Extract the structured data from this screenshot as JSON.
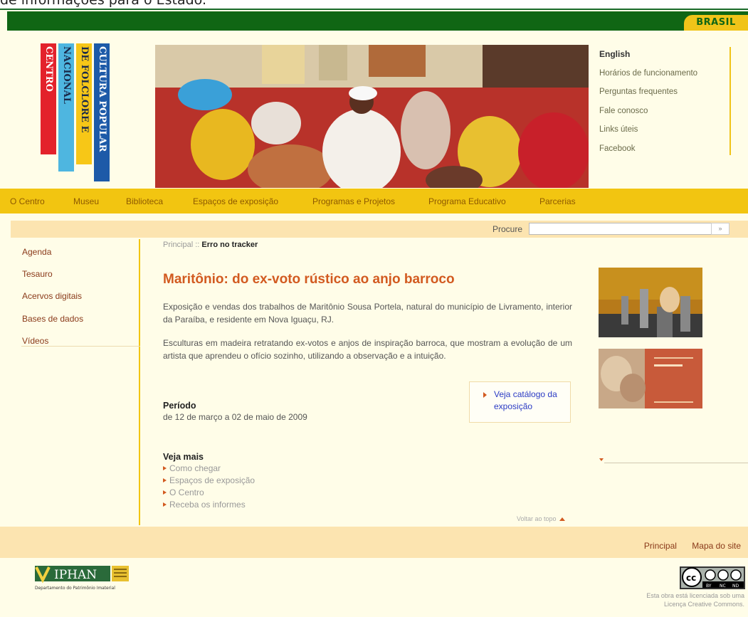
{
  "top_clip_text": "de informações para o Estado.",
  "gov_bar": {
    "brasil_label": "BRASIL"
  },
  "logo": {
    "line1": "CENTRO",
    "line2": "NACIONAL",
    "line3": "DE FOLCLORE E",
    "line4": "CULTURA POPULAR",
    "colors": [
      "#e3222b",
      "#4eb6e0",
      "#f7c717",
      "#1d5aa8"
    ]
  },
  "top_links": [
    "English",
    "Horários de funcionamento",
    "Perguntas frequentes",
    "Fale conosco",
    "Links úteis",
    "Facebook"
  ],
  "nav": [
    "O Centro",
    "Museu",
    "Biblioteca",
    "Espaços de exposição",
    "Programas e Projetos",
    "Programa Educativo",
    "Parcerias"
  ],
  "search": {
    "label": "Procure",
    "value": "",
    "button": "»"
  },
  "sidebar": [
    "Agenda",
    "Tesauro",
    "Acervos digitais",
    "Bases de dados",
    "Vídeos"
  ],
  "breadcrumb": {
    "home": "Principal",
    "sep": " :: ",
    "current": "Erro no tracker"
  },
  "main": {
    "title": "Maritônio: do ex-voto rústico ao anjo barroco",
    "para1": "Exposição e vendas dos trabalhos de Maritônio Sousa Portela, natural do município de Livramento, interior da Paraíba, e residente em Nova Iguaçu, RJ.",
    "para2": "Esculturas em madeira retratando ex-votos e anjos de inspiração barroca, que mostram a evolução de um artista que aprendeu o ofício sozinho, utilizando a observação e a intuição.",
    "catalog_link": "Veja catálogo da exposição",
    "period_label": "Período",
    "period_value": "de 12 de março a 02 de maio de 2009",
    "seemore_title": "Veja mais",
    "seemore_items": [
      "Como chegar",
      "Espaços de exposição",
      "O Centro",
      "Receba os informes"
    ],
    "back_to_top": "Voltar ao topo"
  },
  "footer": {
    "links": [
      "Principal",
      "Mapa do site"
    ],
    "iphan_name": "IPHAN",
    "iphan_sub": "Departamento do Patrimônio Imaterial",
    "cc_labels": [
      "BY",
      "NC",
      "ND"
    ],
    "license_line1": "Esta obra está licenciada sob uma",
    "license_line2": "Licença Creative Commons."
  }
}
